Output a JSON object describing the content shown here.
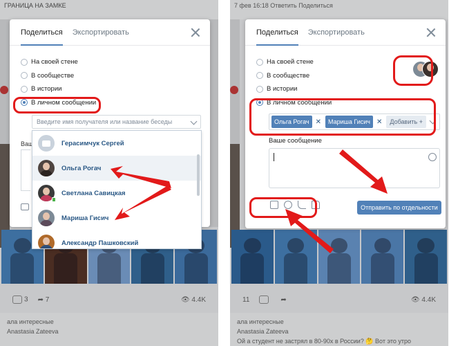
{
  "left": {
    "feed_top": {
      "line1": "",
      "line2": "ГРАНИЦА НА ЗАМКЕ",
      "meta": ""
    },
    "tabs": {
      "share": "Поделиться",
      "export": "Экспортировать"
    },
    "options": [
      "На своей стене",
      "В сообществе",
      "В истории",
      "В личном сообщении"
    ],
    "recipient_placeholder": "Введите имя получателя или название беседы",
    "hint_fragment": "Ваш",
    "dropdown": [
      "Герасимчук Сергей",
      "Ольга Рогач",
      "Светлана Савицкая",
      "Мариша Гисич",
      "Александр Пашковский"
    ],
    "actions": {
      "comments": "3",
      "shares": "7",
      "views": "4.4K"
    },
    "bottom": {
      "line1": "ала интересные",
      "line2": "Anastasia Zateeva"
    }
  },
  "right": {
    "feed_top": {
      "line1": "",
      "line2": "",
      "meta": "7 фев 16:18  Ответить  Поделиться"
    },
    "tabs": {
      "share": "Поделиться",
      "export": "Экспортировать"
    },
    "options": [
      "На своей стене",
      "В сообществе",
      "В истории",
      "В личном сообщении"
    ],
    "tokens": [
      "Ольга Рогач",
      "Мариша Гисич"
    ],
    "add_label": "Добавить",
    "message_label": "Ваше сообщение",
    "send_label": "Отправить по отдельности",
    "actions": {
      "comments": "11",
      "shares": "",
      "views": "4.4K"
    },
    "bottom": {
      "line1": "ала интересные",
      "line2": "Anastasia Zateeva",
      "line3": "Ой а студент не застрял в 80-90х в России? 🤔 Вот это утро"
    }
  },
  "colors": {
    "accent": "#5181b8",
    "highlight_red": "#e21a1a",
    "link": "#2a5885",
    "overlay": "#c7c8ca"
  },
  "icons": [
    "close-icon",
    "chevron-down-icon",
    "camera-icon",
    "video-icon",
    "music-icon",
    "document-icon",
    "smile-icon",
    "comment-icon",
    "share-icon",
    "eye-icon"
  ]
}
